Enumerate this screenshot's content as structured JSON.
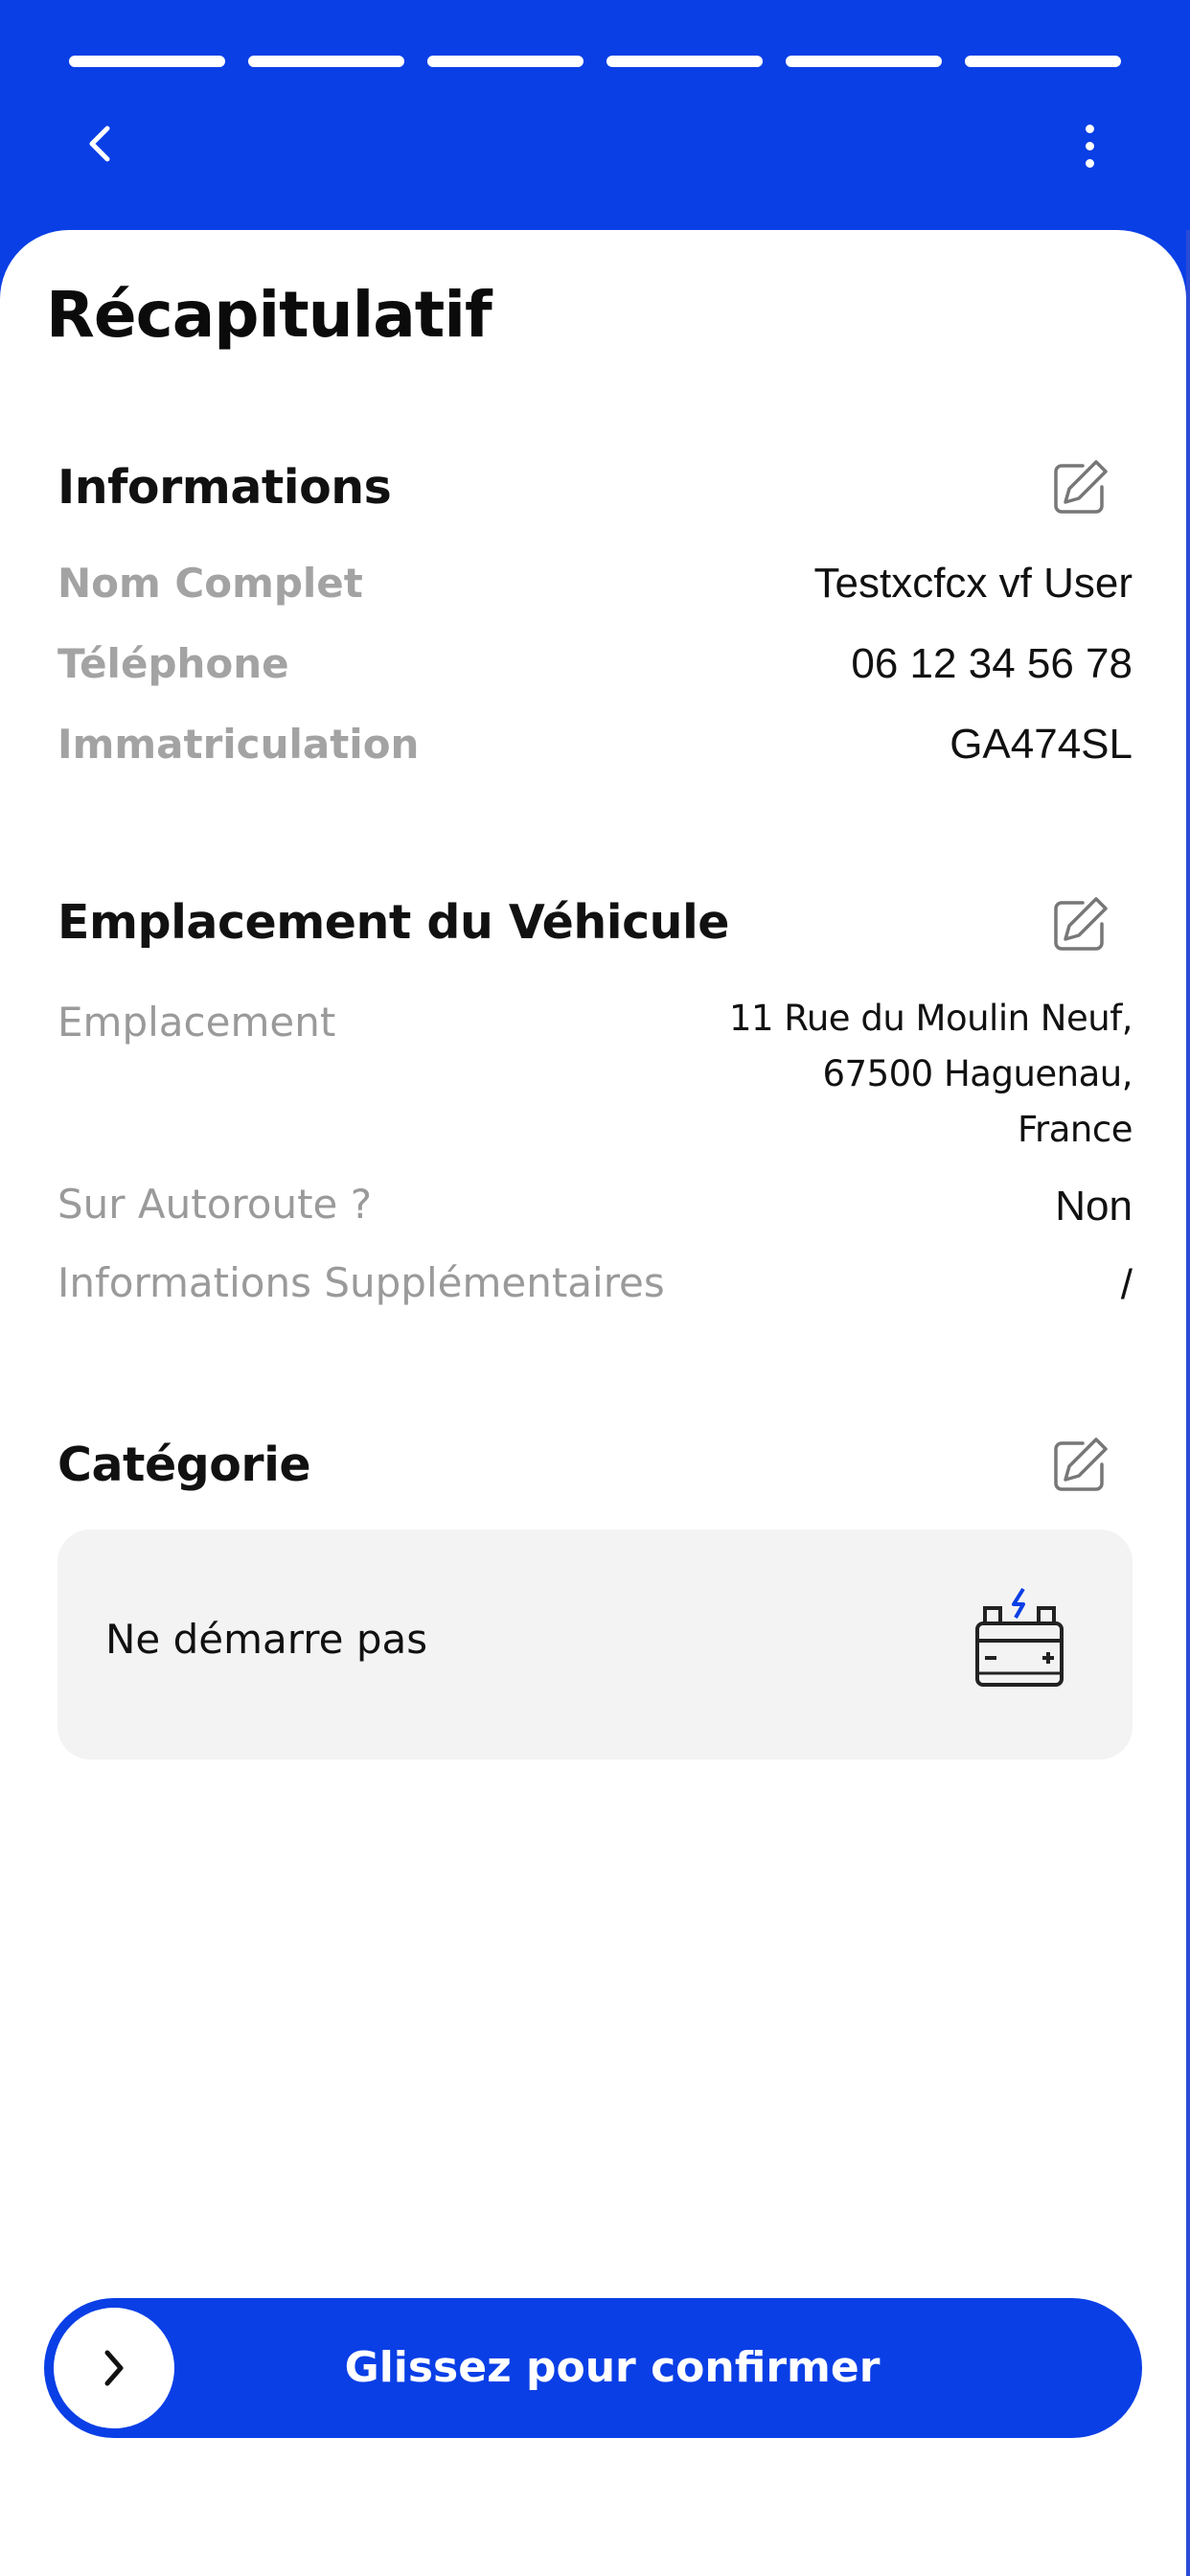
{
  "progress": {
    "total_steps": 6,
    "completed_steps": 6
  },
  "header": {
    "back_icon": "chevron-left-icon",
    "menu_icon": "more-vertical-icon"
  },
  "page": {
    "title": "Récapitulatif"
  },
  "informations": {
    "title": "Informations",
    "rows": [
      {
        "label": "Nom Complet",
        "value": "Testxcfcx vf User"
      },
      {
        "label": "Téléphone",
        "value": "06 12 34 56 78"
      },
      {
        "label": "Immatriculation",
        "value": "GA474SL"
      }
    ]
  },
  "emplacement": {
    "title": "Emplacement du Véhicule",
    "address_label": "Emplacement",
    "address_lines": [
      "11 Rue du Moulin Neuf,",
      "67500 Haguenau,",
      "France"
    ],
    "rows": [
      {
        "label": "Sur Autoroute ?",
        "value": "Non"
      },
      {
        "label": "Informations Supplémentaires",
        "value": "/"
      }
    ]
  },
  "categorie": {
    "title": "Catégorie",
    "selected": "Ne démarre pas",
    "icon": "car-battery-icon"
  },
  "slider": {
    "label": "Glissez pour confirmer",
    "knob_icon": "chevron-right-icon"
  },
  "colors": {
    "primary": "#0a3fe6",
    "background": "#ffffff",
    "muted_text": "#9a9a9a",
    "card_bg": "#f3f3f3"
  }
}
